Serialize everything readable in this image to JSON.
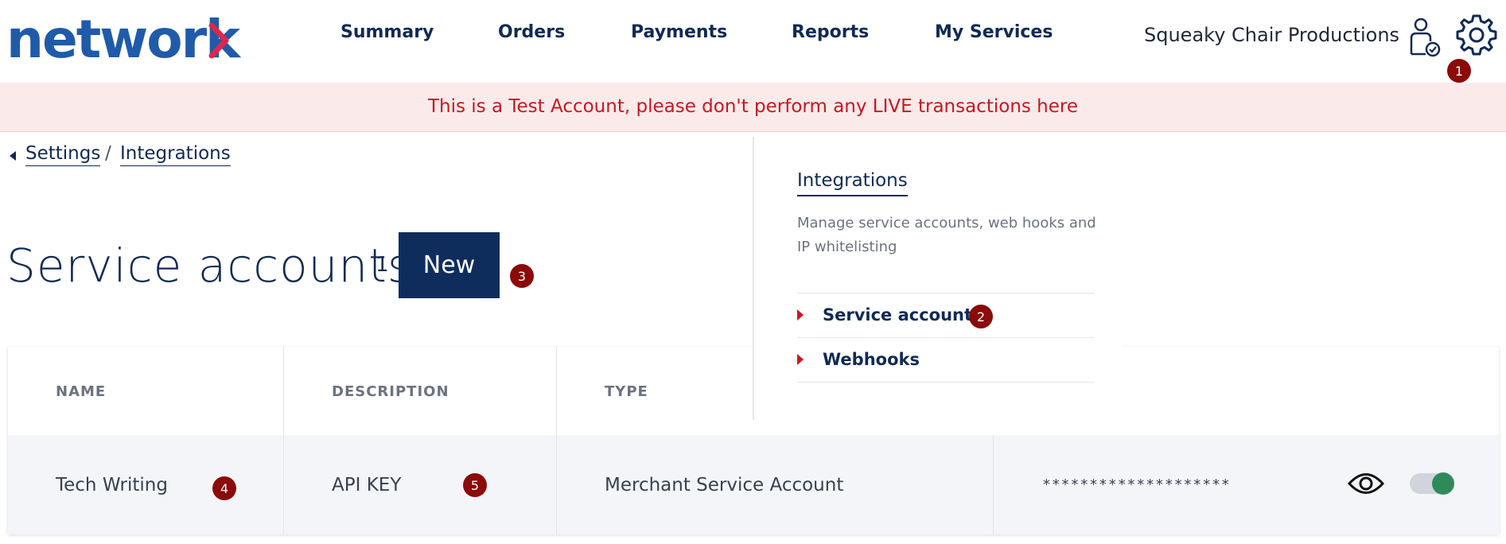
{
  "header": {
    "logo_text": "network",
    "nav": [
      {
        "label": "Summary"
      },
      {
        "label": "Orders"
      },
      {
        "label": "Payments"
      },
      {
        "label": "Reports"
      },
      {
        "label": "My Services"
      }
    ],
    "account_name": "Squeaky Chair Productions",
    "user_icon": "user-check-icon",
    "settings_icon": "gear-icon"
  },
  "banner": {
    "text": "This is a Test Account, please don't perform any LIVE transactions here"
  },
  "breadcrumb": {
    "items": [
      "Settings",
      "Integrations"
    ],
    "separator": "/"
  },
  "page": {
    "title": "Service accounts",
    "count": "1",
    "new_button": "New"
  },
  "table": {
    "columns": [
      "NAME",
      "DESCRIPTION",
      "TYPE"
    ],
    "rows": [
      {
        "name": "Tech Writing",
        "description": "API KEY",
        "type": "Merchant Service Account",
        "key_masked": "********************",
        "enabled": true
      }
    ]
  },
  "panel": {
    "title": "Integrations",
    "description": "Manage service accounts, web hooks and IP whitelisting",
    "items": [
      {
        "label": "Service account"
      },
      {
        "label": "Webhooks"
      }
    ]
  },
  "badges": [
    "1",
    "2",
    "3",
    "4",
    "5"
  ],
  "colors": {
    "brand_blue": "#1f5ba8",
    "navy": "#0f2d5c",
    "alert_red": "#c7181e",
    "badge": "#8b0a0a",
    "toggle_on": "#2f8a5a"
  }
}
